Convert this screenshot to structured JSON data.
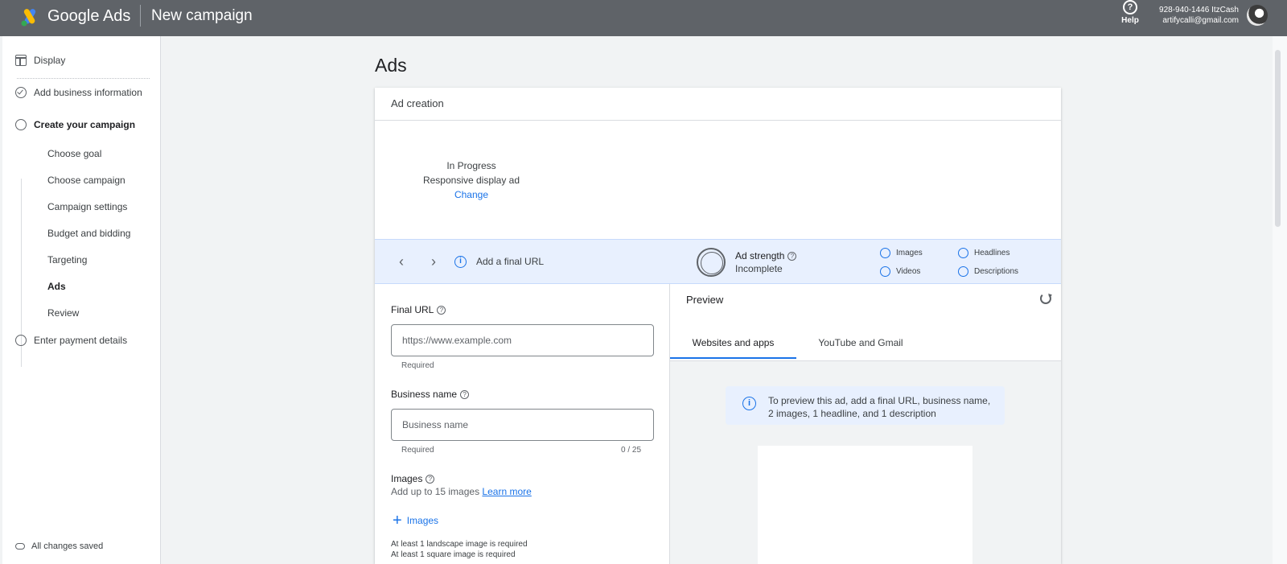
{
  "header": {
    "brand": "Google Ads",
    "page_title": "New campaign",
    "help_label": "Help",
    "account_line1": "928-940-1446 ItzCash",
    "account_line2": "artifycalli@gmail.com"
  },
  "sidebar": {
    "display": "Display",
    "add_business": "Add business information",
    "create_campaign": "Create your campaign",
    "steps": [
      "Choose goal",
      "Choose campaign",
      "Campaign settings",
      "Budget and bidding",
      "Targeting",
      "Ads",
      "Review"
    ],
    "payment": "Enter payment details",
    "saved": "All changes saved"
  },
  "main": {
    "title": "Ads",
    "card_title": "Ad creation",
    "progress_status": "In Progress",
    "ad_type": "Responsive display ad",
    "change": "Change"
  },
  "strength": {
    "hint": "Add a final URL",
    "label": "Ad strength",
    "status": "Incomplete",
    "criteria": [
      "Images",
      "Headlines",
      "Videos",
      "Descriptions"
    ]
  },
  "form": {
    "final_url_label": "Final URL",
    "final_url_placeholder": "https://www.example.com",
    "final_url_hint": "Required",
    "business_label": "Business name",
    "business_placeholder": "Business name",
    "business_hint": "Required",
    "business_counter": "0 / 25",
    "images_label": "Images",
    "images_sub": "Add up to 15 images",
    "learn_more": "Learn more",
    "add_images": "Images",
    "req_landscape": "At least 1 landscape image is required",
    "req_square": "At least 1 square image is required"
  },
  "preview": {
    "title": "Preview",
    "tabs": [
      "Websites and apps",
      "YouTube and Gmail"
    ],
    "notice": "To preview this ad, add a final URL, business name, 2 images, 1 headline, and 1 description"
  }
}
